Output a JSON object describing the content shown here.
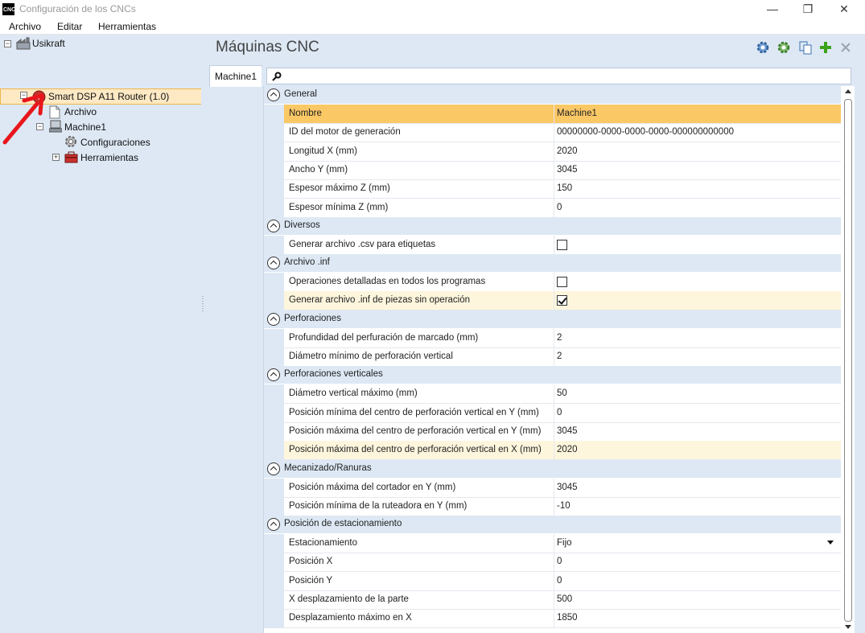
{
  "window": {
    "icon_text": "CNC",
    "title": "Configuración de los CNCs",
    "minimize": "—",
    "restore": "❐",
    "close": "✕"
  },
  "menu": [
    "Archivo",
    "Editar",
    "Herramientas"
  ],
  "tree": {
    "root": "Usikraft",
    "router": "Smart DSP A11 Router (1.0)",
    "archivo": "Archivo",
    "machine": "Machine1",
    "configuraciones": "Configuraciones",
    "herramientas": "Herramientas",
    "toggle_expanded": "−",
    "toggle_collapsed": "+"
  },
  "main": {
    "title": "Máquinas CNC",
    "toolbar_icons": [
      "gear-blue-icon",
      "gear-green-icon",
      "copy-icon",
      "add-icon",
      "delete-icon"
    ],
    "tab": "Machine1",
    "search_placeholder": ""
  },
  "property_grid": {
    "categories": [
      {
        "label": "General",
        "rows": [
          {
            "name": "Nombre",
            "value": "Machine1",
            "state": "selected"
          },
          {
            "name": "ID del motor de generación",
            "value": "00000000-0000-0000-0000-000000000000"
          },
          {
            "name": "Longitud X (mm)",
            "value": "2020"
          },
          {
            "name": "Ancho Y (mm)",
            "value": "3045"
          },
          {
            "name": "Espesor máximo Z (mm)",
            "value": "150"
          },
          {
            "name": "Espesor mínima Z (mm)",
            "value": "0"
          }
        ]
      },
      {
        "label": "Diversos",
        "rows": [
          {
            "name": "Generar archivo .csv para etiquetas",
            "checkbox": false
          }
        ]
      },
      {
        "label": "Archivo .inf",
        "rows": [
          {
            "name": "Operaciones detalladas en todos los programas",
            "checkbox": false
          },
          {
            "name": "Generar archivo .inf de piezas sin operación",
            "checkbox": true,
            "state": "hover"
          }
        ]
      },
      {
        "label": "Perforaciones",
        "rows": [
          {
            "name": "Profundidad del perfuración de marcado (mm)",
            "value": "2"
          },
          {
            "name": "Diámetro mínimo de perforación vertical",
            "value": "2"
          }
        ]
      },
      {
        "label": "Perforaciones verticales",
        "rows": [
          {
            "name": "Diámetro vertical máximo (mm)",
            "value": "50"
          },
          {
            "name": "Posición mínima del centro de perforación vertical en Y (mm)",
            "value": "0"
          },
          {
            "name": "Posición máxima del centro de perforación vertical en Y (mm)",
            "value": "3045"
          },
          {
            "name": "Posición máxima del centro de perforación vertical en X (mm)",
            "value": "2020",
            "state": "hover"
          }
        ]
      },
      {
        "label": "Mecanizado/Ranuras",
        "rows": [
          {
            "name": "Posición máxima del cortador en Y (mm)",
            "value": "3045"
          },
          {
            "name": "Posición mínima de la ruteadora en Y (mm)",
            "value": "-10"
          }
        ]
      },
      {
        "label": "Posición de estacionamiento",
        "rows": [
          {
            "name": "Estacionamiento",
            "value": "Fijo",
            "dropdown": true
          },
          {
            "name": "Posición X",
            "value": "0"
          },
          {
            "name": "Posición Y",
            "value": "0"
          },
          {
            "name": "X desplazamiento de la parte",
            "value": "500"
          },
          {
            "name": "Desplazamiento máximo en X",
            "value": "1850"
          }
        ]
      }
    ]
  },
  "colors": {
    "panel_bg": "#dde8f4",
    "selected_row": "#fbc866",
    "hover_row": "#fdf6dd",
    "tree_selected": "#fde9c4",
    "annotation_arrow": "#e8161b"
  }
}
